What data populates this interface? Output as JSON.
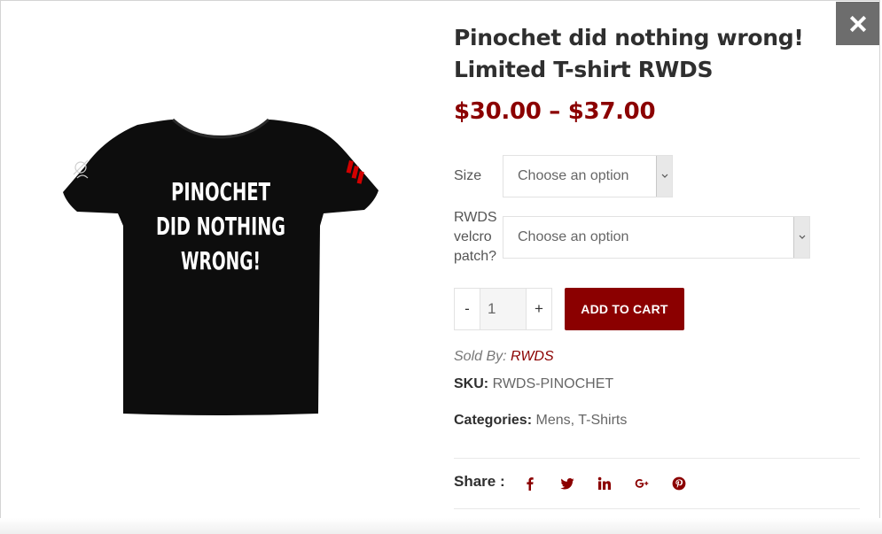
{
  "close": {
    "icon": "close-icon"
  },
  "product": {
    "title": "Pinochet did nothing wrong! Limited T-shirt RWDS",
    "price": "$30.00 – $37.00",
    "shirt_print": [
      "PINOCHET",
      "DID NOTHING",
      "WRONG!"
    ],
    "shirt_color": "#0d0d0d",
    "accent_color": "#8b0000"
  },
  "variations": {
    "size": {
      "label": "Size",
      "value": "Choose an option"
    },
    "patch": {
      "label": [
        "RWDS",
        "velcro",
        "patch?"
      ],
      "value": "Choose an option"
    }
  },
  "quantity": {
    "minus": "-",
    "value": "1",
    "plus": "+"
  },
  "add_to_cart": "ADD TO CART",
  "meta": {
    "sold_by_label": "Sold By:",
    "vendor": "RWDS",
    "sku_label": "SKU:",
    "sku": "RWDS-PINOCHET",
    "categories_label": "Categories:",
    "categories": [
      "Mens",
      "T-Shirts"
    ],
    "category_separator": ","
  },
  "share": {
    "label": "Share :",
    "icons": [
      "facebook-icon",
      "twitter-icon",
      "linkedin-icon",
      "google-plus-icon",
      "pinterest-icon"
    ]
  }
}
